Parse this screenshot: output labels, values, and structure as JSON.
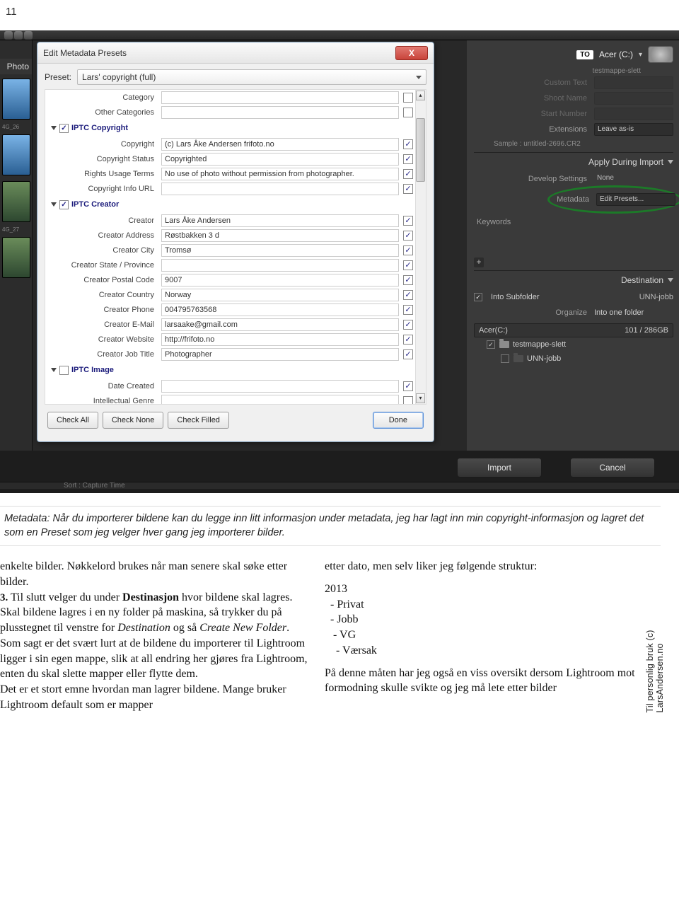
{
  "page_number": "11",
  "dialog": {
    "title": "Edit Metadata Presets",
    "preset_label": "Preset:",
    "preset_value": "Lars' copyright (full)",
    "rows_top": [
      {
        "label": "Category",
        "value": "",
        "checked": false
      },
      {
        "label": "Other Categories",
        "value": "",
        "checked": false
      }
    ],
    "sections": [
      {
        "title": "IPTC Copyright",
        "sec_checked": true,
        "rows": [
          {
            "label": "Copyright",
            "value": "(c) Lars Åke Andersen frifoto.no",
            "checked": true
          },
          {
            "label": "Copyright Status",
            "value": "Copyrighted",
            "checked": true
          },
          {
            "label": "Rights Usage Terms",
            "value": "No use of photo without permission from photographer.",
            "checked": true
          },
          {
            "label": "Copyright Info URL",
            "value": "",
            "checked": true
          }
        ]
      },
      {
        "title": "IPTC Creator",
        "sec_checked": true,
        "rows": [
          {
            "label": "Creator",
            "value": "Lars Åke Andersen",
            "checked": true
          },
          {
            "label": "Creator Address",
            "value": "Røstbakken 3 d",
            "checked": true
          },
          {
            "label": "Creator City",
            "value": "Tromsø",
            "checked": true
          },
          {
            "label": "Creator State / Province",
            "value": "",
            "checked": true
          },
          {
            "label": "Creator Postal Code",
            "value": "9007",
            "checked": true
          },
          {
            "label": "Creator Country",
            "value": "Norway",
            "checked": true
          },
          {
            "label": "Creator Phone",
            "value": "004795763568",
            "checked": true
          },
          {
            "label": "Creator E-Mail",
            "value": "larsaake@gmail.com",
            "checked": true
          },
          {
            "label": "Creator Website",
            "value": "http://frifoto.no",
            "checked": true
          },
          {
            "label": "Creator Job Title",
            "value": "Photographer",
            "checked": true
          }
        ]
      },
      {
        "title": "IPTC Image",
        "sec_checked": false,
        "rows": [
          {
            "label": "Date Created",
            "value": "",
            "checked": true
          },
          {
            "label": "Intellectual Genre",
            "value": "",
            "checked": false
          }
        ]
      }
    ],
    "buttons": {
      "check_all": "Check All",
      "check_none": "Check None",
      "check_filled": "Check Filled",
      "done": "Done"
    }
  },
  "right_panel": {
    "to_label": "TO",
    "dest_drive": "Acer (C:)",
    "mini_folder": "testmappe-slett",
    "dimmed_rows": [
      {
        "label": "Custom Text",
        "value": ""
      },
      {
        "label": "Shoot Name",
        "value": ""
      },
      {
        "label": "Start Number",
        "value": ""
      }
    ],
    "extensions_label": "Extensions",
    "extensions_value": "Leave as-is",
    "sample_label": "Sample :",
    "sample_value": "untitled-2696.CR2",
    "apply_hdr": "Apply During Import",
    "develop_label": "Develop Settings",
    "develop_value": "None",
    "metadata_label": "Metadata",
    "metadata_value": "Edit Presets...",
    "keywords_label": "Keywords",
    "destination_hdr": "Destination",
    "into_sub_label": "Into Subfolder",
    "into_sub_value": "UNN-jobb",
    "organize_label": "Organize",
    "organize_value": "Into one folder",
    "volume_name": "Acer(C:)",
    "volume_cap": "101 / 286GB",
    "tree": [
      {
        "name": "testmappe-slett",
        "checked": true,
        "sub": false
      },
      {
        "name": "UNN-jobb",
        "checked": false,
        "sub": true
      }
    ]
  },
  "import_bar": {
    "import": "Import",
    "cancel": "Cancel"
  },
  "left": {
    "tab": "Photo",
    "file1": "4G_26",
    "file2": "4G_27"
  },
  "pref_text": "Sort :   Capture Time",
  "caption": "Metadata: Når du importerer bildene kan du legge inn litt informasjon under metadata, jeg har lagt inn min copyright-informasjon og lagret det som en Preset som jeg velger hver gang jeg importerer bilder.",
  "article": {
    "col1_a": "enkelte bilder. Nøkkelord brukes når man senere skal søke etter bilder.",
    "col1_b_lead": "3.",
    "col1_b": " Til slutt velger du under ",
    "col1_b_bold": "Destinasjon",
    "col1_b2": " hvor bildene skal lagres. Skal bildene lagres i en ny folder på maskina, så trykker du på plusstegnet til venstre for ",
    "col1_b_em1": "Destination",
    "col1_b3": " og så ",
    "col1_b_em2": "Create New Folder",
    "col1_b4": ". Som sagt er det svært lurt at de bildene du importerer til Lightroom ligger i sin egen mappe, slik at all endring her gjøres fra Lightroom, enten du skal slette mapper eller flytte dem.",
    "col1_c": "Det er et stort emne hvordan man lagrer bildene. Mange bruker Lightroom default som er mapper",
    "col2_intro": "etter dato, men selv liker jeg følgende struktur:",
    "col2_tree": "2013\n  - Privat\n  - Jobb\n   - VG\n    - Værsak",
    "col2_out": "På denne måten har jeg også en viss oversikt dersom Lightroom mot formodning skulle svikte og jeg må lete etter bilder"
  },
  "side_text": "Til personlig bruk (c) LarsAndersen.no"
}
